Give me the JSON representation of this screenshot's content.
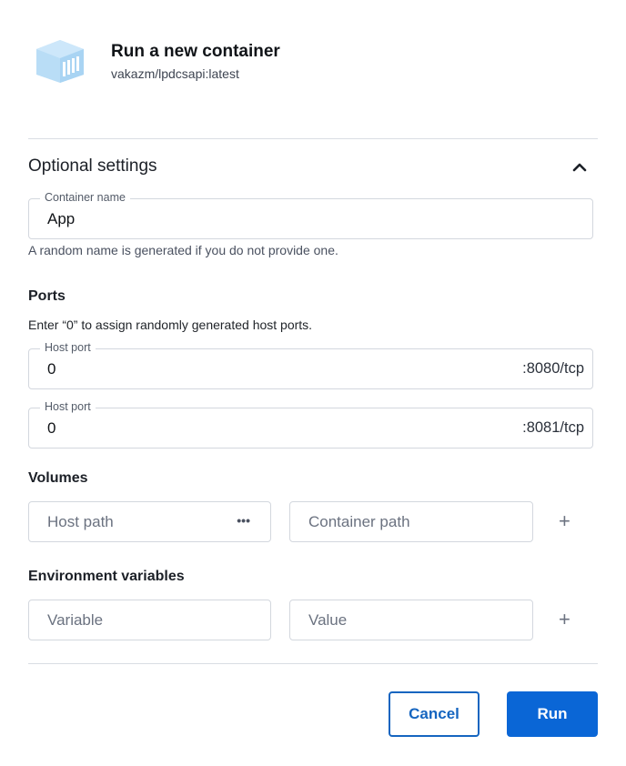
{
  "header": {
    "title": "Run a new container",
    "image": "vakazm/lpdcsapi:latest",
    "icon": "container-image-icon"
  },
  "optional_settings": {
    "title": "Optional settings",
    "collapse_icon": "chevron-up-icon"
  },
  "container_name": {
    "label": "Container name",
    "value": "App",
    "helper": "A random name is generated if you do not provide one."
  },
  "ports": {
    "heading": "Ports",
    "hint": "Enter “0” to assign randomly generated host ports.",
    "items": [
      {
        "label": "Host port",
        "value": "0",
        "container_port": ":8080/tcp"
      },
      {
        "label": "Host port",
        "value": "0",
        "container_port": ":8081/tcp"
      }
    ]
  },
  "volumes": {
    "heading": "Volumes",
    "host_placeholder": "Host path",
    "browse_icon": "•••",
    "container_placeholder": "Container path",
    "add_icon": "+"
  },
  "env": {
    "heading": "Environment variables",
    "variable_placeholder": "Variable",
    "value_placeholder": "Value",
    "add_icon": "+"
  },
  "actions": {
    "cancel": "Cancel",
    "run": "Run"
  },
  "colors": {
    "primary": "#0a66d6",
    "icon_blue": "#b3daf7"
  }
}
